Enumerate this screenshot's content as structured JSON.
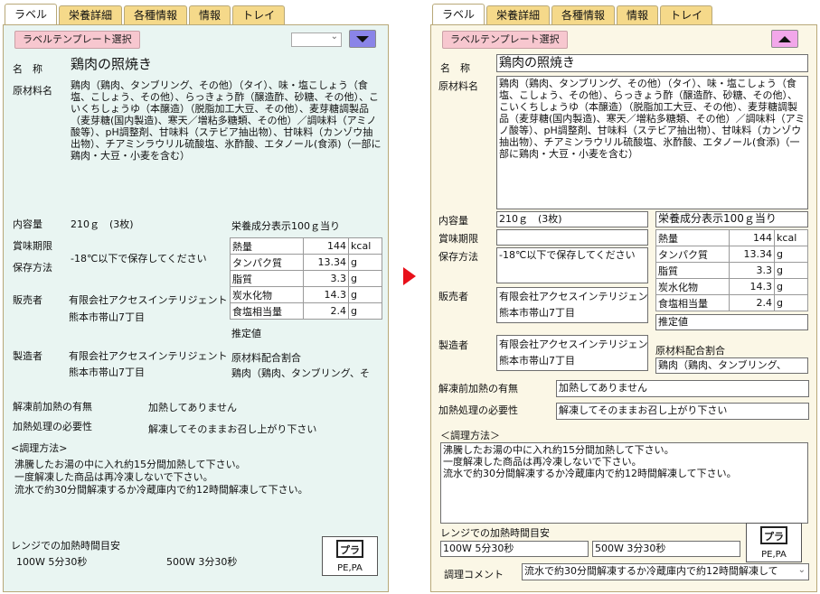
{
  "tabs": [
    "ラベル",
    "栄養詳細",
    "各種情報",
    "情報",
    "トレイ"
  ],
  "template_button": "ラベルテンプレート選択",
  "labels": {
    "name_left": "名　称",
    "name_right": "名　称",
    "ingredients": "原材料名",
    "content": "内容量",
    "expiry": "賞味期限",
    "storage": "保存方法",
    "seller": "販売者",
    "maker": "製造者",
    "thaw": "解凍前加熱の有無",
    "heat": "加熱処理の必要性",
    "method": "<調理方法>",
    "method_right": "＜調理方法＞",
    "range": "レンジでの加熱時間目安",
    "comment": "調理コメント",
    "nutrition_title": "栄養成分表示100ｇ当り",
    "estimated": "推定値",
    "ratio": "原材料配合割合"
  },
  "values": {
    "name": "鶏肉の照焼き",
    "ingredients": "鶏肉（鶏肉、タンブリング、その他）（タイ）、味・塩こしょう（食塩、こしょう、その他）、らっきょう酢（醸造酢、砂糖、その他）、こいくちしょうゆ（本醸造）（脱脂加工大豆、その他）、麦芽糖調製品（麦芽糖(国内製造)、寒天／増粘多糖類、その他）／調味料（アミノ酸等）、pH調整剤、甘味料（ステビア抽出物）、甘味料（カンゾウ抽出物）、チアミンラウリル硫酸塩、氷酢酸、エタノール(食添)（一部に鶏肉・大豆・小麦を含む）",
    "content": "210ｇ　(3枚)",
    "storage": "-18℃以下で保存してください",
    "seller_1": "有限会社アクセスインテリジェント",
    "seller_2": "熊本市帯山7丁目",
    "maker_1": "有限会社アクセスインテリジェント",
    "maker_2": "熊本市帯山7丁目",
    "ratio_text": "鶏肉（鶏肉、タンブリング、そ",
    "ratio_text_right": "鶏肉（鶏肉、タンブリング、",
    "thaw": "加熱してありません",
    "heat": "解凍してそのままお召し上がり下さい",
    "method_lines": [
      "沸騰したお湯の中に入れ約15分間加熱して下さい。",
      "一度解凍した商品は再冷凍しないで下さい。",
      "流水で約30分間解凍するか冷蔵庫内で約12時間解凍して下さい。"
    ],
    "range_100w": "100W 5分30秒",
    "range_500w": "500W 3分30秒",
    "comment": "流水で約30分間解凍するか冷蔵庫内で約12時間解凍して"
  },
  "nutrition": [
    {
      "name": "熱量",
      "value": "144",
      "unit": "kcal"
    },
    {
      "name": "タンパク質",
      "value": "13.34",
      "unit": "g"
    },
    {
      "name": "脂質",
      "value": "3.3",
      "unit": "g"
    },
    {
      "name": "炭水化物",
      "value": "14.3",
      "unit": "g"
    },
    {
      "name": "食塩相当量",
      "value": "2.4",
      "unit": "g"
    }
  ],
  "recycle_mark": "PE,PA",
  "colors": {
    "left_bg": "#e9f5f2",
    "right_bg": "#fbf7e6",
    "tab": "#f5d98a",
    "toggle_left": "#8a84e8",
    "toggle_right": "#f2a7ea",
    "arrow": "#e8101a"
  }
}
